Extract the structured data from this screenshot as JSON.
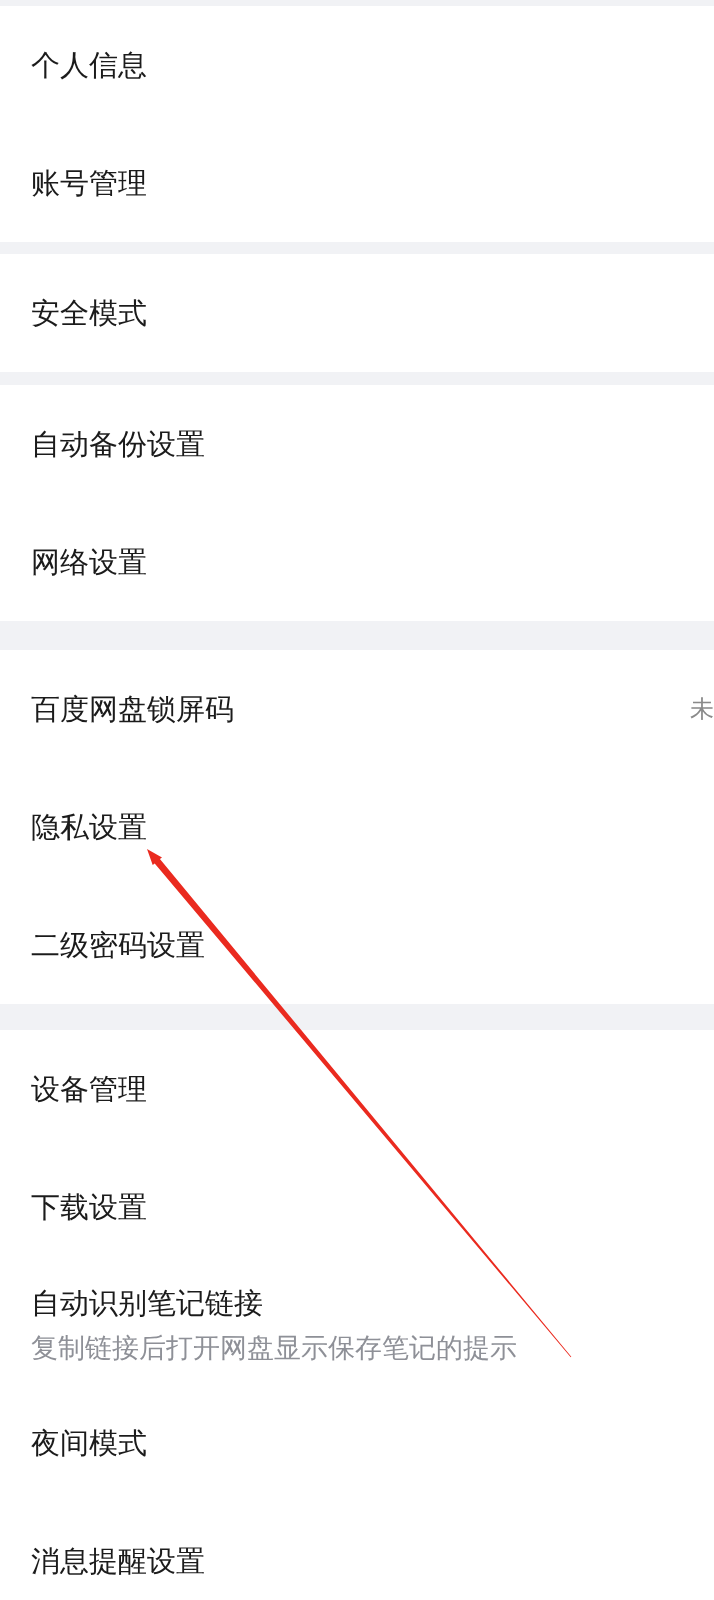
{
  "groups": [
    {
      "items": [
        {
          "label": "个人信息"
        },
        {
          "label": "账号管理"
        }
      ]
    },
    {
      "items": [
        {
          "label": "安全模式"
        }
      ]
    },
    {
      "items": [
        {
          "label": "自动备份设置"
        },
        {
          "label": "网络设置"
        }
      ]
    },
    {
      "items": [
        {
          "label": "百度网盘锁屏码",
          "value": "未"
        },
        {
          "label": "隐私设置"
        },
        {
          "label": "二级密码设置"
        }
      ]
    },
    {
      "items": [
        {
          "label": "设备管理"
        },
        {
          "label": "下载设置"
        },
        {
          "label": "自动识别笔记链接",
          "description": "复制链接后打开网盘显示保存笔记的提示"
        },
        {
          "label": "夜间模式"
        },
        {
          "label": "消息提醒设置"
        }
      ]
    }
  ]
}
